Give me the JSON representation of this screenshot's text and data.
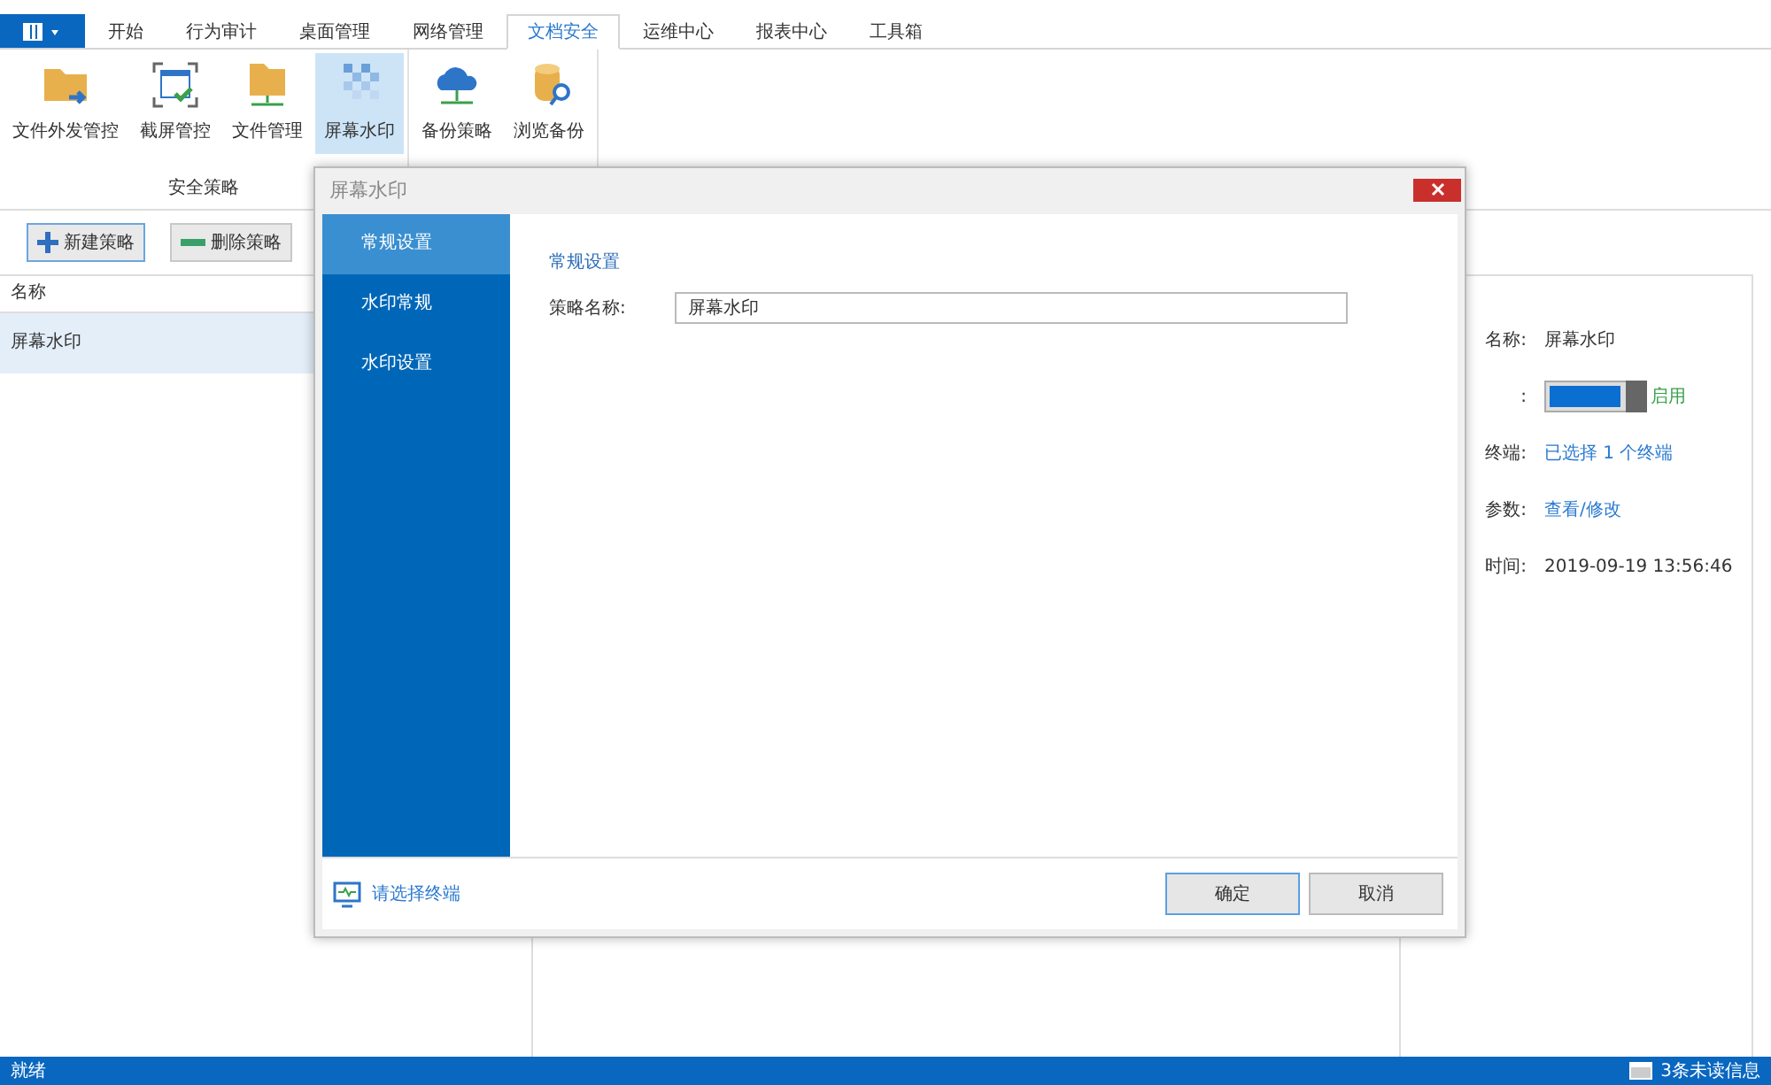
{
  "ribbon": {
    "tabs": [
      {
        "label": "开始",
        "selected": false
      },
      {
        "label": "行为审计",
        "selected": false
      },
      {
        "label": "桌面管理",
        "selected": false
      },
      {
        "label": "网络管理",
        "selected": false
      },
      {
        "label": "文档安全",
        "selected": true
      },
      {
        "label": "运维中心",
        "selected": false
      },
      {
        "label": "报表中心",
        "selected": false
      },
      {
        "label": "工具箱",
        "selected": false
      }
    ],
    "groups": [
      {
        "label": "安全策略",
        "buttons": [
          {
            "label": "文件外发管控",
            "selected": false
          },
          {
            "label": "截屏管控",
            "selected": false
          },
          {
            "label": "文件管理",
            "selected": false
          },
          {
            "label": "屏幕水印",
            "selected": true
          }
        ]
      },
      {
        "buttons": [
          {
            "label": "备份策略",
            "selected": false
          },
          {
            "label": "浏览备份",
            "selected": false
          }
        ]
      }
    ]
  },
  "toolbar": [
    {
      "label": "新建策略",
      "kind": "add",
      "focused": true
    },
    {
      "label": "删除策略",
      "kind": "remove",
      "focused": false
    }
  ],
  "list": {
    "column": "名称",
    "rows": [
      {
        "name": "屏幕水印",
        "selected": true
      }
    ]
  },
  "details": {
    "rows": [
      {
        "label": "名称:",
        "value": "屏幕水印",
        "kind": "text"
      },
      {
        "label": ":",
        "kind": "toggle",
        "on": true,
        "state_text": "启用"
      },
      {
        "label": "终端:",
        "value": "已选择 1 个终端",
        "kind": "link"
      },
      {
        "label": "参数:",
        "value": "查看/修改",
        "kind": "link"
      },
      {
        "label": "时间:",
        "value": "2019-09-19 13:56:46",
        "kind": "text"
      }
    ]
  },
  "dialog": {
    "title": "屏幕水印",
    "nav": [
      {
        "label": "常规设置",
        "selected": true
      },
      {
        "label": "水印常规",
        "selected": false
      },
      {
        "label": "水印设置",
        "selected": false
      }
    ],
    "section": "常规设置",
    "field_label": "策略名称:",
    "field_value": "屏幕水印",
    "terminal_link": "请选择终端",
    "buttons": [
      {
        "label": "确定",
        "focused": true
      },
      {
        "label": "取消",
        "focused": false
      }
    ]
  },
  "status_bar": {
    "left": "就绪",
    "messages": "3条未读信息"
  }
}
